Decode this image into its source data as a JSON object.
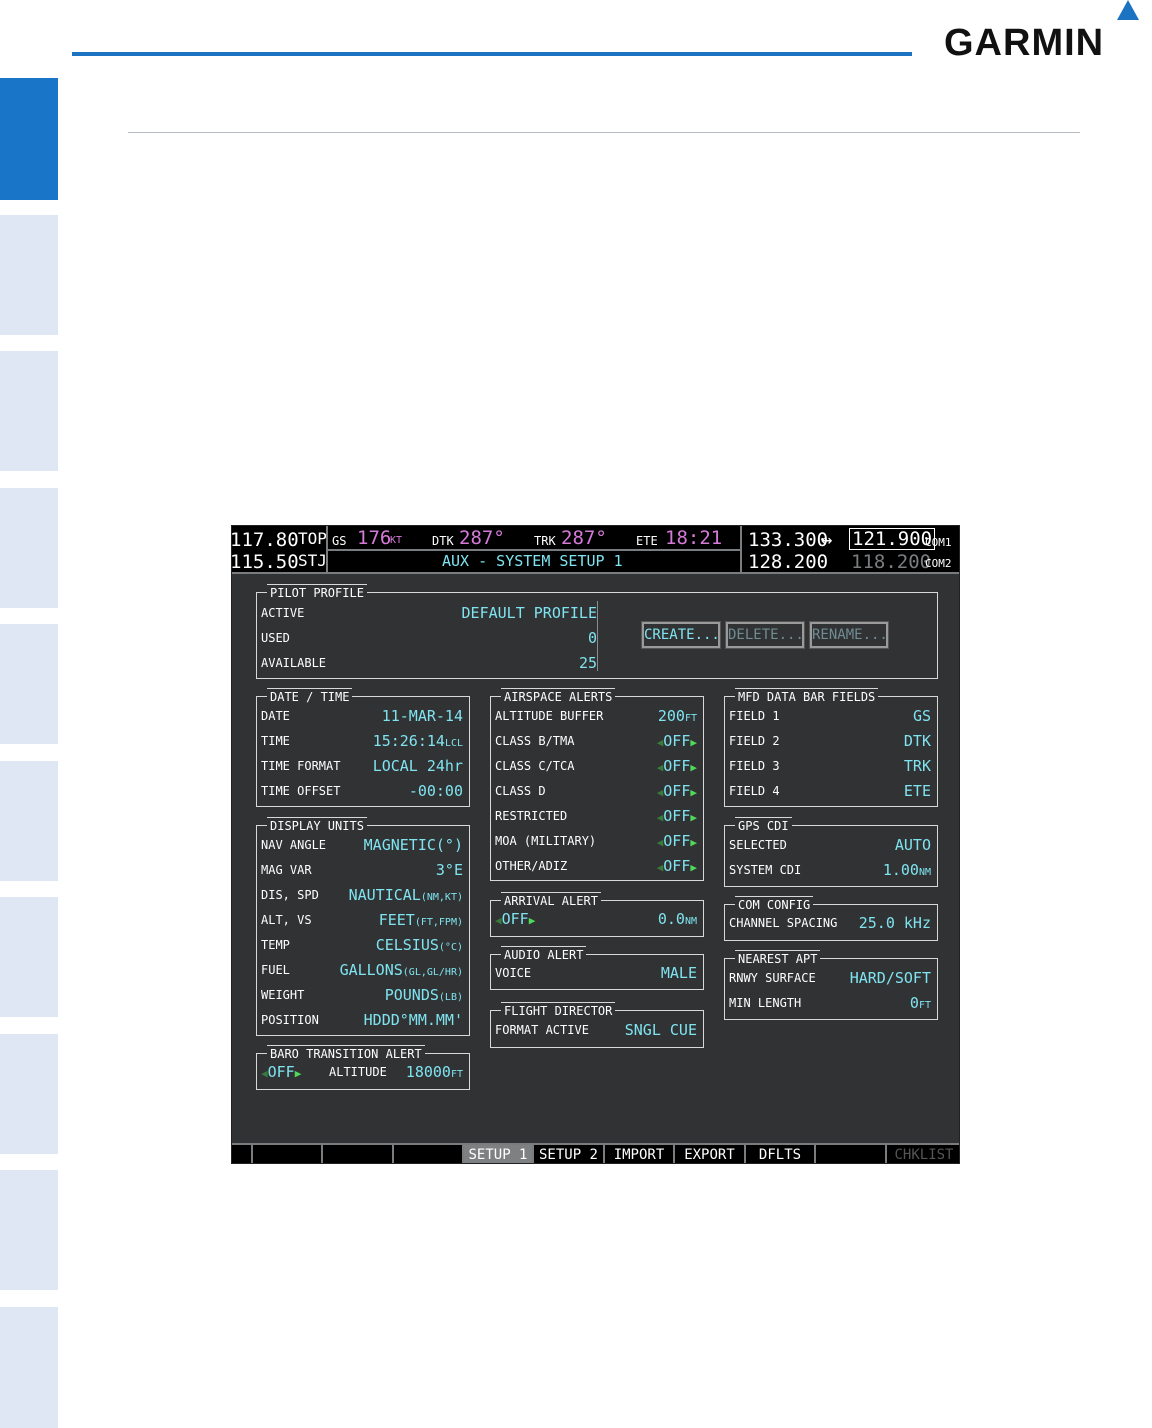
{
  "brand": {
    "name": "GARMIN"
  },
  "mfd": {
    "nav": {
      "active": "117.80",
      "active_id": "TOP",
      "standby": "115.50",
      "standby_id": "STJ"
    },
    "data_bar": {
      "gs_label": "GS",
      "gs_value": "176",
      "gs_unit": "KT",
      "dtk_label": "DTK",
      "dtk_value": "287°",
      "trk_label": "TRK",
      "trk_value": "287°",
      "ete_label": "ETE",
      "ete_value": "18:21"
    },
    "page_title": "AUX - SYSTEM SETUP 1",
    "com": {
      "com1_standby": "133.300",
      "com1_active": "121.900",
      "com1_label": "COM1",
      "com2_standby": "128.200",
      "com2_active": "118.200",
      "com2_label": "COM2",
      "swap_arrow": "↔"
    },
    "pilot_profile": {
      "title": "PILOT PROFILE",
      "active_label": "ACTIVE",
      "active_value": "DEFAULT PROFILE",
      "used_label": "USED",
      "used_value": "0",
      "available_label": "AVAILABLE",
      "available_value": "25",
      "create": "CREATE...",
      "delete": "DELETE...",
      "rename": "RENAME..."
    },
    "date_time": {
      "title": "DATE / TIME",
      "rows": [
        {
          "label": "DATE",
          "value": "11-MAR-14"
        },
        {
          "label": "TIME",
          "value": "15:26:14",
          "unit": "LCL"
        },
        {
          "label": "TIME FORMAT",
          "value": "LOCAL 24hr"
        },
        {
          "label": "TIME OFFSET",
          "value": "-00:00"
        }
      ]
    },
    "display_units": {
      "title": "DISPLAY UNITS",
      "rows": [
        {
          "label": "NAV ANGLE",
          "value": "MAGNETIC(°)"
        },
        {
          "label": "MAG VAR",
          "value": "3°E"
        },
        {
          "label": "DIS, SPD",
          "value": "NAUTICAL",
          "unit": "(NM,KT)"
        },
        {
          "label": "ALT, VS",
          "value": "FEET",
          "unit": "(FT,FPM)"
        },
        {
          "label": "TEMP",
          "value": "CELSIUS",
          "unit": "(°C)"
        },
        {
          "label": "FUEL",
          "value": "GALLONS",
          "unit": "(GL,GL/HR)"
        },
        {
          "label": "WEIGHT",
          "value": "POUNDS",
          "unit": "(LB)"
        },
        {
          "label": "POSITION",
          "value": "HDDD°MM.MM'"
        }
      ]
    },
    "baro_alert": {
      "title": "BARO TRANSITION ALERT",
      "state": "OFF",
      "altitude_label": "ALTITUDE",
      "altitude_value": "18000",
      "altitude_unit": "FT"
    },
    "airspace_alerts": {
      "title": "AIRSPACE ALERTS",
      "altitude_buffer_label": "ALTITUDE BUFFER",
      "altitude_buffer_value": "200",
      "altitude_buffer_unit": "FT",
      "rows": [
        {
          "label": "CLASS B/TMA",
          "value": "OFF"
        },
        {
          "label": "CLASS C/TCA",
          "value": "OFF"
        },
        {
          "label": "CLASS D",
          "value": "OFF"
        },
        {
          "label": "RESTRICTED",
          "value": "OFF"
        },
        {
          "label": "MOA (MILITARY)",
          "value": "OFF"
        },
        {
          "label": "OTHER/ADIZ",
          "value": "OFF"
        }
      ]
    },
    "arrival_alert": {
      "title": "ARRIVAL ALERT",
      "state": "OFF",
      "distance": "0.0",
      "unit": "NM"
    },
    "audio_alert": {
      "title": "AUDIO ALERT",
      "label": "VOICE",
      "value": "MALE"
    },
    "flight_director": {
      "title": "FLIGHT DIRECTOR",
      "label": "FORMAT ACTIVE",
      "value": "SNGL CUE"
    },
    "mfd_data_bar": {
      "title": "MFD DATA BAR FIELDS",
      "rows": [
        {
          "label": "FIELD 1",
          "value": "GS"
        },
        {
          "label": "FIELD 2",
          "value": "DTK"
        },
        {
          "label": "FIELD 3",
          "value": "TRK"
        },
        {
          "label": "FIELD 4",
          "value": "ETE"
        }
      ]
    },
    "gps_cdi": {
      "title": "GPS CDI",
      "selected_label": "SELECTED",
      "selected_value": "AUTO",
      "system_label": "SYSTEM CDI",
      "system_value": "1.00",
      "system_unit": "NM"
    },
    "com_config": {
      "title": "COM CONFIG",
      "label": "CHANNEL SPACING",
      "value": "25.0 kHz"
    },
    "nearest_apt": {
      "title": "NEAREST APT",
      "surface_label": "RNWY SURFACE",
      "surface_value": "HARD/SOFT",
      "length_label": "MIN LENGTH",
      "length_value": "0",
      "length_unit": "FT"
    },
    "softkeys": [
      "",
      "",
      "",
      "",
      "SETUP 1",
      "SETUP 2",
      "IMPORT",
      "EXPORT",
      "DFLTS",
      "",
      "CHKLIST"
    ]
  }
}
